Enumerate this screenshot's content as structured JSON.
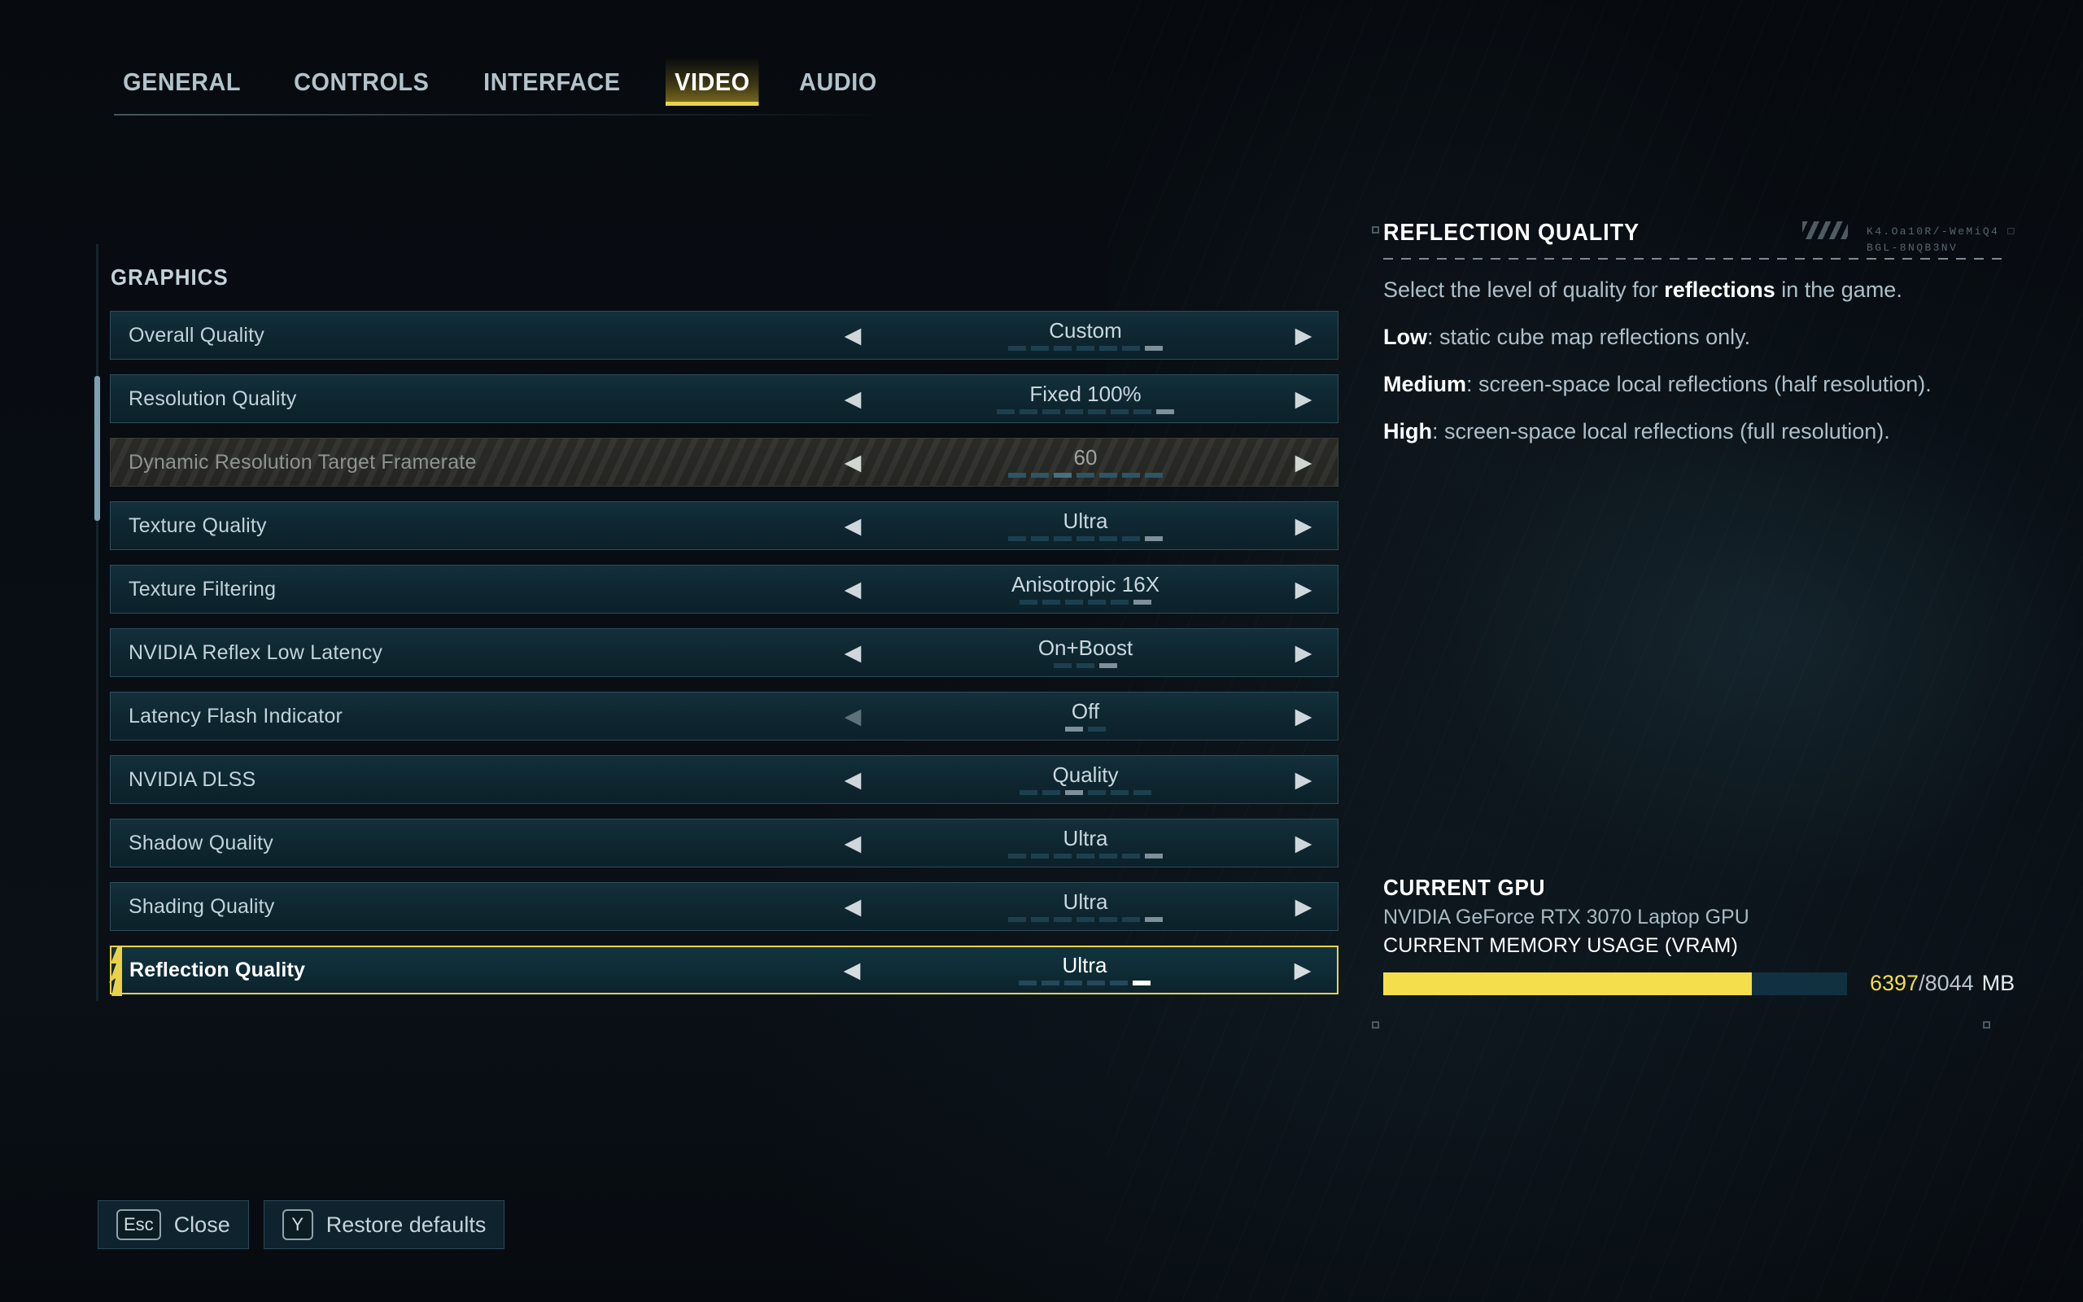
{
  "tabs": [
    {
      "label": "GENERAL",
      "active": false
    },
    {
      "label": "CONTROLS",
      "active": false
    },
    {
      "label": "INTERFACE",
      "active": false
    },
    {
      "label": "VIDEO",
      "active": true
    },
    {
      "label": "AUDIO",
      "active": false
    }
  ],
  "section": {
    "title": "GRAPHICS"
  },
  "settings": [
    {
      "label": "Overall Quality",
      "value": "Custom",
      "segments": 7,
      "active_index": 6,
      "state": "normal",
      "left_arrow": "enabled",
      "right_arrow": "enabled"
    },
    {
      "label": "Resolution Quality",
      "value": "Fixed 100%",
      "segments": 8,
      "active_index": 7,
      "state": "normal",
      "left_arrow": "enabled",
      "right_arrow": "enabled"
    },
    {
      "label": "Dynamic Resolution Target Framerate",
      "value": "60",
      "segments": 7,
      "active_index": 2,
      "state": "disabled",
      "left_arrow": "enabled",
      "right_arrow": "enabled"
    },
    {
      "label": "Texture Quality",
      "value": "Ultra",
      "segments": 7,
      "active_index": 6,
      "state": "normal",
      "left_arrow": "enabled",
      "right_arrow": "enabled"
    },
    {
      "label": "Texture Filtering",
      "value": "Anisotropic 16X",
      "segments": 6,
      "active_index": 5,
      "state": "normal",
      "left_arrow": "enabled",
      "right_arrow": "enabled"
    },
    {
      "label": "NVIDIA Reflex Low Latency",
      "value": "On+Boost",
      "segments": 3,
      "active_index": 2,
      "state": "normal",
      "left_arrow": "enabled",
      "right_arrow": "enabled"
    },
    {
      "label": "Latency Flash Indicator",
      "value": "Off",
      "segments": 2,
      "active_index": 0,
      "state": "normal",
      "left_arrow": "dimmed",
      "right_arrow": "enabled"
    },
    {
      "label": "NVIDIA DLSS",
      "value": "Quality",
      "segments": 6,
      "active_index": 2,
      "state": "normal",
      "left_arrow": "enabled",
      "right_arrow": "enabled"
    },
    {
      "label": "Shadow Quality",
      "value": "Ultra",
      "segments": 7,
      "active_index": 6,
      "state": "normal",
      "left_arrow": "enabled",
      "right_arrow": "enabled"
    },
    {
      "label": "Shading Quality",
      "value": "Ultra",
      "segments": 7,
      "active_index": 6,
      "state": "normal",
      "left_arrow": "enabled",
      "right_arrow": "enabled"
    },
    {
      "label": "Reflection Quality",
      "value": "Ultra",
      "segments": 6,
      "active_index": 5,
      "state": "selected",
      "left_arrow": "enabled",
      "right_arrow": "enabled"
    }
  ],
  "info_panel": {
    "title": "REFLECTION QUALITY",
    "paragraphs": [
      {
        "lead": "",
        "lead_text": "Select the level of quality for ",
        "bold": "reflections",
        "tail": " in the game."
      },
      {
        "lead": "Low",
        "lead_text": "",
        "bold": "",
        "tail": ": static cube map reflections only."
      },
      {
        "lead": "Medium",
        "lead_text": "",
        "bold": "",
        "tail": ": screen-space local reflections (half resolution)."
      },
      {
        "lead": "High",
        "lead_text": "",
        "bold": "",
        "tail": ": screen-space local reflections (full resolution)."
      }
    ]
  },
  "gpu": {
    "heading": "CURRENT GPU",
    "name": "NVIDIA GeForce RTX 3070 Laptop GPU",
    "vram_heading": "CURRENT MEMORY USAGE (VRAM)",
    "vram_used": "6397",
    "vram_separator": "/8044",
    "vram_unit": "MB",
    "vram_percent": "79.5%"
  },
  "decoration": {
    "code_line_1": "K4.Oa10R/-WeMiQ4  □",
    "code_line_2": "BGL-8NQB3NV"
  },
  "footer": {
    "buttons": [
      {
        "key": "Esc",
        "label": "Close"
      },
      {
        "key": "Y",
        "label": "Restore defaults"
      }
    ]
  },
  "colors": {
    "accent_yellow": "#e9d24a",
    "vram_yellow": "#f5de4c",
    "row_bg": "#0e2630",
    "row_border": "#2d4d5a",
    "text_primary": "#c2d2db",
    "text_white": "#ffffff"
  }
}
